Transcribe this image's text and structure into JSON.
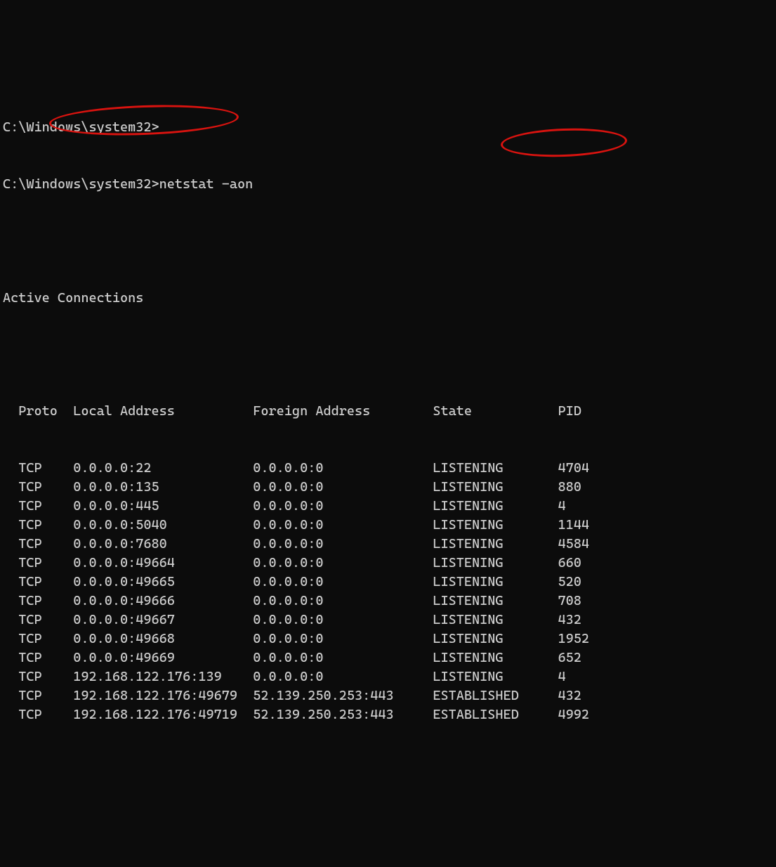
{
  "prompt1": "C:\\Windows\\system32>",
  "prompt2_path": "C:\\Windows\\system32>",
  "prompt2_cmd": "netstat -aon",
  "title": "Active Connections",
  "headers": {
    "proto": "Proto",
    "local": "Local Address",
    "foreign": "Foreign Address",
    "state": "State",
    "pid": "PID"
  },
  "rows": [
    {
      "proto": "TCP",
      "local": "0.0.0.0:22",
      "foreign": "0.0.0.0:0",
      "state": "LISTENING",
      "pid": "4704"
    },
    {
      "proto": "TCP",
      "local": "0.0.0.0:135",
      "foreign": "0.0.0.0:0",
      "state": "LISTENING",
      "pid": "880"
    },
    {
      "proto": "TCP",
      "local": "0.0.0.0:445",
      "foreign": "0.0.0.0:0",
      "state": "LISTENING",
      "pid": "4"
    },
    {
      "proto": "TCP",
      "local": "0.0.0.0:5040",
      "foreign": "0.0.0.0:0",
      "state": "LISTENING",
      "pid": "1144"
    },
    {
      "proto": "TCP",
      "local": "0.0.0.0:7680",
      "foreign": "0.0.0.0:0",
      "state": "LISTENING",
      "pid": "4584"
    },
    {
      "proto": "TCP",
      "local": "0.0.0.0:49664",
      "foreign": "0.0.0.0:0",
      "state": "LISTENING",
      "pid": "660"
    },
    {
      "proto": "TCP",
      "local": "0.0.0.0:49665",
      "foreign": "0.0.0.0:0",
      "state": "LISTENING",
      "pid": "520"
    },
    {
      "proto": "TCP",
      "local": "0.0.0.0:49666",
      "foreign": "0.0.0.0:0",
      "state": "LISTENING",
      "pid": "708"
    },
    {
      "proto": "TCP",
      "local": "0.0.0.0:49667",
      "foreign": "0.0.0.0:0",
      "state": "LISTENING",
      "pid": "432"
    },
    {
      "proto": "TCP",
      "local": "0.0.0.0:49668",
      "foreign": "0.0.0.0:0",
      "state": "LISTENING",
      "pid": "1952"
    },
    {
      "proto": "TCP",
      "local": "0.0.0.0:49669",
      "foreign": "0.0.0.0:0",
      "state": "LISTENING",
      "pid": "652"
    },
    {
      "proto": "TCP",
      "local": "192.168.122.176:139",
      "foreign": "0.0.0.0:0",
      "state": "LISTENING",
      "pid": "4"
    },
    {
      "proto": "TCP",
      "local": "192.168.122.176:49679",
      "foreign": "52.139.250.253:443",
      "state": "ESTABLISHED",
      "pid": "432"
    },
    {
      "proto": "TCP",
      "local": "192.168.122.176:49719",
      "foreign": "52.139.250.253:443",
      "state": "ESTABLISHED",
      "pid": "4992"
    }
  ]
}
